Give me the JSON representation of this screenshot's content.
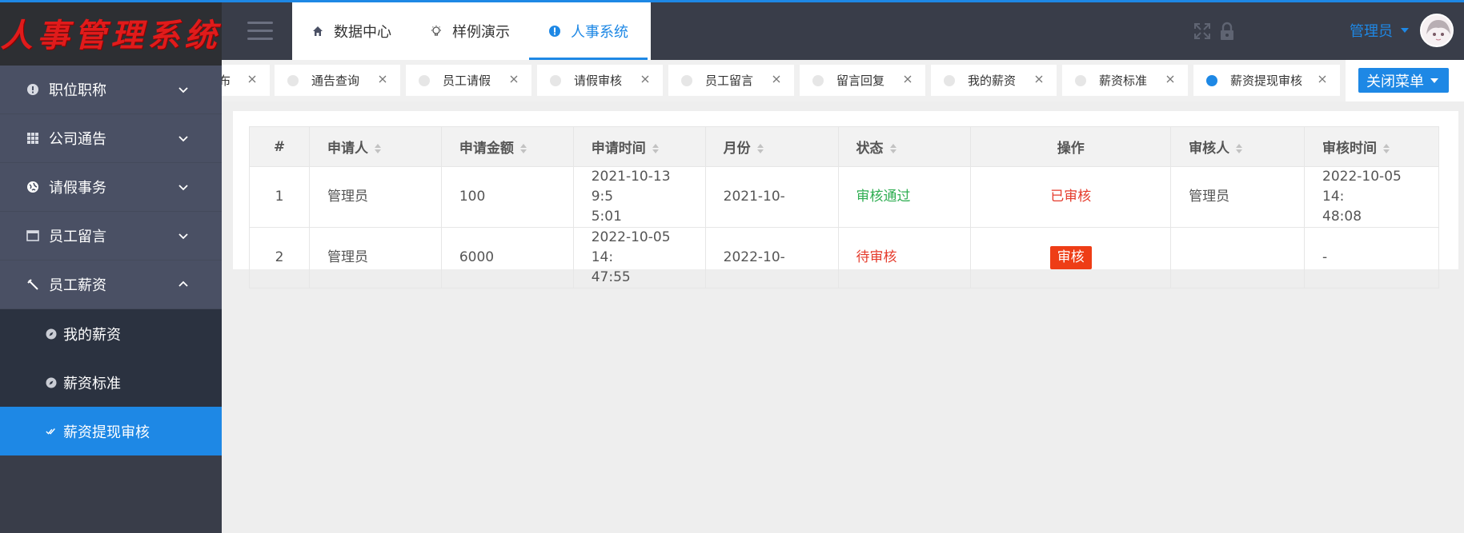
{
  "app": {
    "logo_text": "人事管理系统"
  },
  "sidebar": {
    "items": [
      {
        "label": "职位职称",
        "icon": "info-circle-icon",
        "expanded": false
      },
      {
        "label": "公司通告",
        "icon": "grid-icon",
        "expanded": false
      },
      {
        "label": "请假事务",
        "icon": "globe-icon",
        "expanded": false
      },
      {
        "label": "员工留言",
        "icon": "window-icon",
        "expanded": false
      },
      {
        "label": "员工薪资",
        "icon": "wrench-icon",
        "expanded": true
      }
    ],
    "sub_items": [
      {
        "label": "我的薪资",
        "icon": "compass-icon",
        "active": false
      },
      {
        "label": "薪资标准",
        "icon": "compass-icon",
        "active": false
      },
      {
        "label": "薪资提现审核",
        "icon": "double-check-icon",
        "active": true
      }
    ]
  },
  "header": {
    "tabs": [
      {
        "label": "数据中心",
        "icon": "home-icon"
      },
      {
        "label": "样例演示",
        "icon": "bulb-icon"
      },
      {
        "label": "人事系统",
        "icon": "info-icon",
        "active": true
      }
    ],
    "user_name": "管理员",
    "accent": "#1e88e5"
  },
  "page_tabs": [
    {
      "label": "布"
    },
    {
      "label": "通告查询"
    },
    {
      "label": "员工请假"
    },
    {
      "label": "请假审核"
    },
    {
      "label": "员工留言"
    },
    {
      "label": "留言回复"
    },
    {
      "label": "我的薪资"
    },
    {
      "label": "薪资标准"
    },
    {
      "label": "薪资提现审核",
      "active": true
    }
  ],
  "close_menu_label": "关闭菜单",
  "table": {
    "headers": [
      "#",
      "申请人",
      "申请金额",
      "申请时间",
      "月份",
      "状态",
      "操作",
      "审核人",
      "审核时间"
    ],
    "rows": [
      {
        "no": "1",
        "applicant": "管理员",
        "amount": "100",
        "time_l1": "2021-10-13 9:5",
        "time_l2": "5:01",
        "month": "2021-10-",
        "status": "审核通过",
        "action": "已审核",
        "reviewer": "管理员",
        "review_l1": "2022-10-05 14:",
        "review_l2": "48:08"
      },
      {
        "no": "2",
        "applicant": "管理员",
        "amount": "6000",
        "time_l1": "2022-10-05 14:",
        "time_l2": "47:55",
        "month": "2022-10-",
        "status": "待审核",
        "action": "审核",
        "reviewer": "",
        "review_l1": "-",
        "review_l2": ""
      }
    ]
  }
}
